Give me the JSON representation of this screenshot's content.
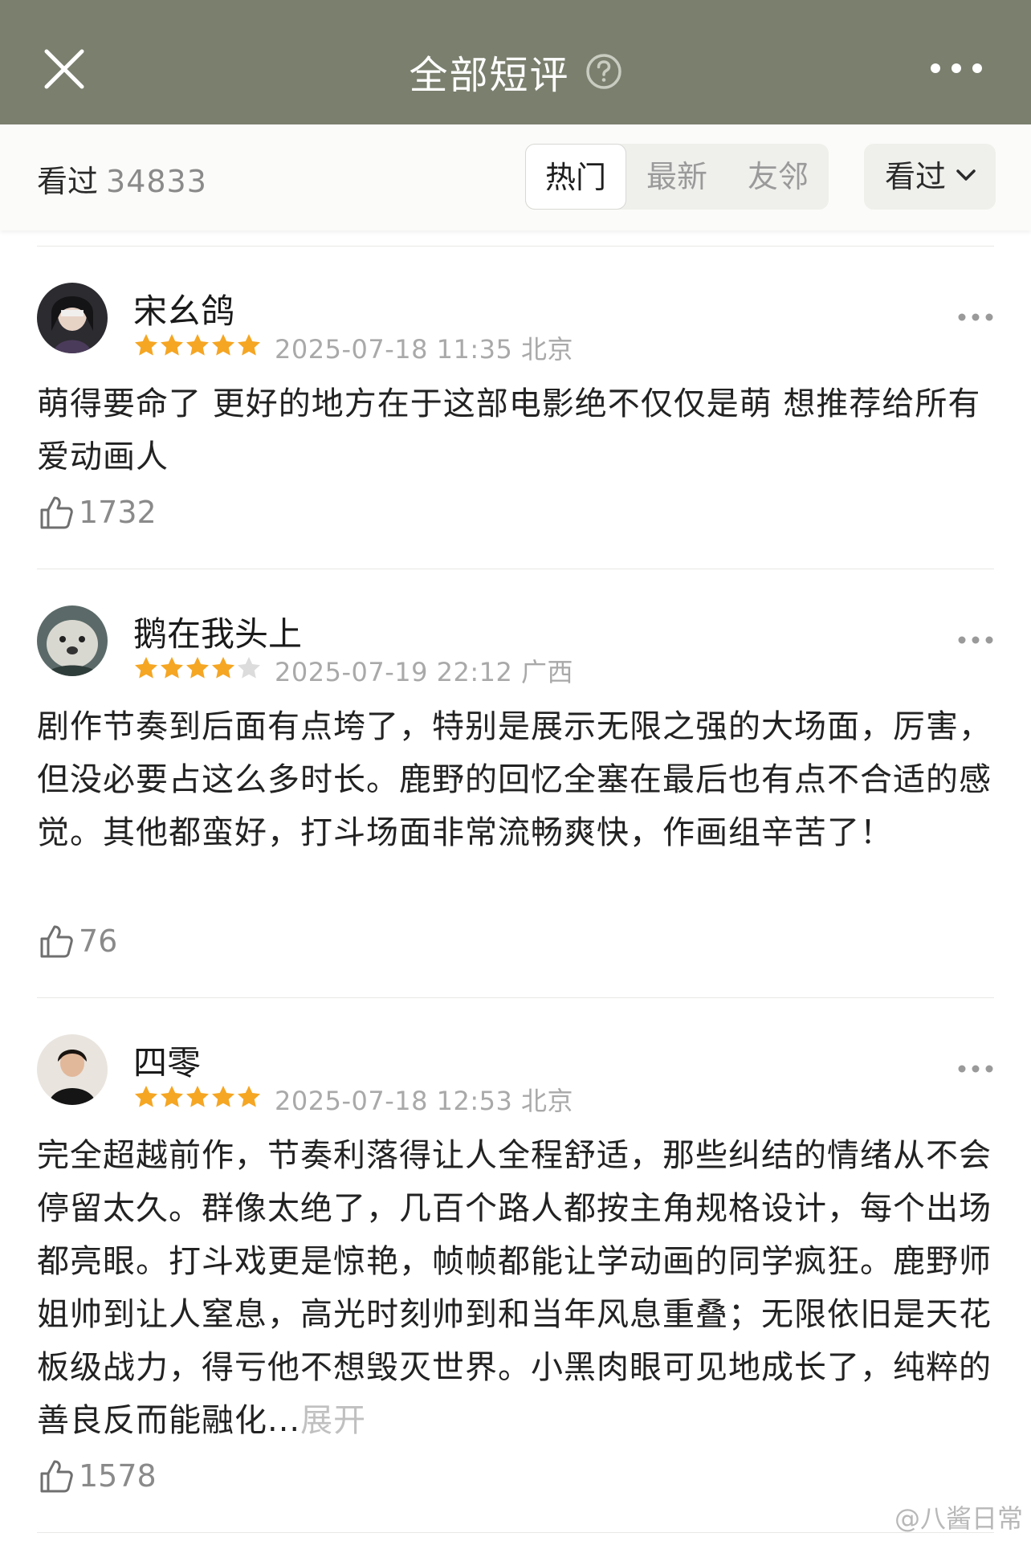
{
  "header": {
    "title": "全部短评",
    "close_icon": "close-icon",
    "help_icon": "question-circle-icon",
    "more_icon": "more-horizontal-icon",
    "bg_color": "#7a7f6e"
  },
  "filter": {
    "seen_label": "看过",
    "seen_count": "34833",
    "tabs": [
      {
        "label": "热门",
        "active": true
      },
      {
        "label": "最新",
        "active": false
      },
      {
        "label": "友邻",
        "active": false
      }
    ],
    "dropdown_label": "看过",
    "dropdown_icon": "chevron-down-icon"
  },
  "reviews": [
    {
      "username": "宋幺鸽",
      "rating": 5,
      "rating_max": 5,
      "datetime": "2025-07-18 11:35",
      "location": "北京",
      "content": "萌得要命了 更好的地方在于这部电影绝不仅仅是萌 想推荐给所有爱动画人",
      "likes": "1732"
    },
    {
      "username": "鹅在我头上",
      "rating": 4,
      "rating_max": 5,
      "datetime": "2025-07-19 22:12",
      "location": "广西",
      "content": "剧作节奏到后面有点垮了，特别是展示无限之强的大场面，厉害，但没必要占这么多时长。鹿野的回忆全塞在最后也有点不合适的感觉。其他都蛮好，打斗场面非常流畅爽快，作画组辛苦了！",
      "likes": "76"
    },
    {
      "username": "四零",
      "rating": 5,
      "rating_max": 5,
      "datetime": "2025-07-18 12:53",
      "location": "北京",
      "content": "完全超越前作，节奏利落得让人全程舒适，那些纠结的情绪从不会停留太久。群像太绝了，几百个路人都按主角规格设计，每个出场都亮眼。打斗戏更是惊艳，帧帧都能让学动画的同学疯狂。鹿野师姐帅到让人窒息，高光时刻帅到和当年风息重叠；无限依旧是天花板级战力，得亏他不想毁灭世界。小黑肉眼可见地成长了，纯粹的善良反而能融化...",
      "expand_label": "展开",
      "likes": "1578"
    }
  ],
  "colors": {
    "star_on": "#f5a623",
    "star_off": "#dcdcdc",
    "meta_text": "#a9a9a9"
  },
  "watermark": "@八酱日常"
}
